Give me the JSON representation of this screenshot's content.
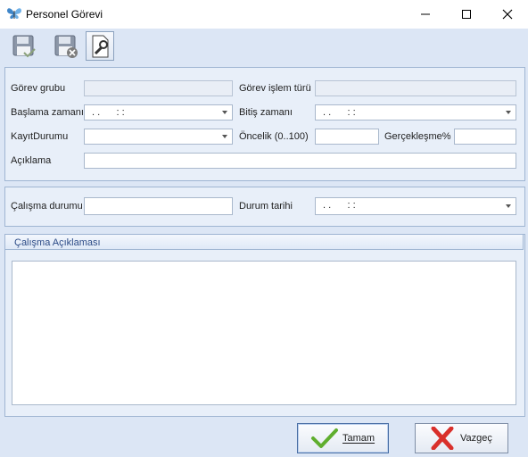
{
  "window": {
    "title": "Personel Görevi",
    "icon": "butterfly-icon",
    "controls": [
      "minimize-icon",
      "maximize-icon",
      "close-icon"
    ]
  },
  "toolbar": {
    "buttons": [
      {
        "name": "save-icon"
      },
      {
        "name": "delete-icon"
      },
      {
        "name": "tools-icon"
      }
    ]
  },
  "form": {
    "gorev_grubu_label": "Görev grubu",
    "gorev_grubu_value": "",
    "gorev_islem_turu_label": "Görev işlem türü",
    "gorev_islem_turu_value": "",
    "baslama_zamani_label": "Başlama zamanı",
    "baslama_zamani_value": ". .      : :",
    "bitis_zamani_label": "Bitiş zamanı",
    "bitis_zamani_value": ". .      : :",
    "kayit_durumu_label": "KayıtDurumu",
    "kayit_durumu_value": "",
    "oncelik_label": "Öncelik (0..100)",
    "oncelik_value": "",
    "gerceklesme_label": "Gerçekleşme%",
    "gerceklesme_value": "",
    "aciklama_label": "Açıklama",
    "aciklama_value": ""
  },
  "status": {
    "calisma_durumu_label": "Çalışma durumu",
    "calisma_durumu_value": "",
    "durum_tarihi_label": "Durum tarihi",
    "durum_tarihi_value": ". .      : :"
  },
  "work_description": {
    "header": "Çalışma Açıklaması",
    "value": ""
  },
  "buttons": {
    "ok_label": "Tamam",
    "cancel_label": "Vazgeç"
  },
  "colors": {
    "client_bg": "#dce6f5",
    "group_bg": "#e8eff9",
    "border": "#9fb5d2",
    "header_text": "#2b4a86"
  }
}
